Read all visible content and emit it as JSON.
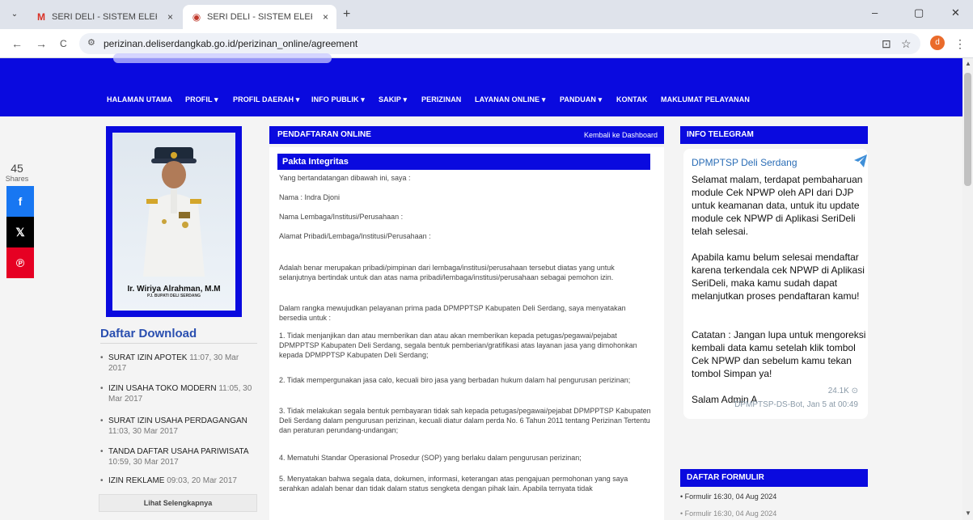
{
  "browser": {
    "tab_menu_icon": "chevron-down-icon",
    "tabs": [
      {
        "title": "SERI DELI - SISTEM ELEKTRONI",
        "icon": "gmail-icon",
        "close": "×"
      },
      {
        "title": "SERI DELI - SISTEM ELEKTRONI",
        "icon": "site-favicon",
        "close": "×"
      }
    ],
    "new_tab": "+",
    "url": "perizinan.deliserdangkab.go.id/perizinan_online/agreement",
    "profile_initial": "d",
    "back": "←",
    "forward": "→",
    "reload": "C",
    "install": "⊡",
    "star": "☆",
    "menu": "⋮",
    "minimize": "–",
    "maximize": "▢",
    "close": "✕"
  },
  "nav": {
    "items": [
      "HALAMAN UTAMA",
      "PROFIL ▾",
      "PROFIL DAERAH ▾",
      "INFO PUBLIK ▾",
      "SAKIP ▾",
      "PERIZINAN",
      "LAYANAN ONLINE ▾",
      "PANDUAN ▾",
      "KONTAK",
      "MAKLUMAT PELAYANAN"
    ]
  },
  "share": {
    "count": "45",
    "label": "Shares",
    "buttons": [
      {
        "name": "facebook",
        "glyph": "f",
        "color": "#1877f2"
      },
      {
        "name": "x",
        "glyph": "𝕏",
        "color": "#000000"
      },
      {
        "name": "pinterest",
        "glyph": "℗",
        "color": "#e60023"
      }
    ]
  },
  "profile": {
    "name": "Ir. Wiriya Alrahman, M.M",
    "title": "PJ. BUPATI DELI SERDANG"
  },
  "downloads": {
    "title": "Daftar Download",
    "items": [
      {
        "name": "SURAT IZIN APOTEK",
        "date": "11:07, 30 Mar 2017"
      },
      {
        "name": "IZIN USAHA TOKO MODERN",
        "date": "11:05, 30 Mar 2017"
      },
      {
        "name": "SURAT IZIN USAHA PERDAGANGAN",
        "date": "11:03, 30 Mar 2017"
      },
      {
        "name": "TANDA DAFTAR USAHA PARIWISATA",
        "date": "10:59, 30 Mar 2017"
      },
      {
        "name": "IZIN REKLAME",
        "date": "09:03, 20 Mar 2017"
      }
    ],
    "more": "Lihat Selengkapnya"
  },
  "main": {
    "title": "PENDAFTARAN ONLINE",
    "back_link": "Kembali ke Dashboard",
    "section": "Pakta Integritas",
    "paragraphs": [
      "Yang bertandatangan dibawah ini, saya :",
      "Nama : Indra Djoni",
      "Nama Lembaga/Institusi/Perusahaan :",
      "Alamat Pribadi/Lembaga/Institusi/Perusahaan :",
      "Adalah benar merupakan pribadi/pimpinan dari lembaga/institusi/perusahaan tersebut diatas yang untuk selanjutnya bertindak untuk dan atas nama pribadi/lembaga/institusi/perusahaan sebagai pemohon izin.",
      "Dalam rangka mewujudkan pelayanan prima pada DPMPPTSP Kabupaten Deli Serdang, saya menyatakan bersedia untuk :",
      "1. Tidak menjanjikan dan atau memberikan dan atau akan memberikan kepada petugas/pegawai/pejabat DPMPPTSP Kabupaten Deli Serdang, segala bentuk pemberian/gratifikasi atas layanan jasa yang dimohonkan kepada DPMPPTSP Kabupaten Deli Serdang;",
      "2. Tidak mempergunakan jasa calo, kecuali biro jasa yang berbadan hukum dalam hal pengurusan perizinan;",
      "3. Tidak melakukan segala bentuk pembayaran tidak sah kepada petugas/pegawai/pejabat DPMPPTSP Kabupaten Deli Serdang dalam pengurusan perizinan, kecuali diatur dalam perda No. 6 Tahun 2011 tentang Perizinan Tertentu dan peraturan perundang-undangan;",
      "4. Mematuhi Standar Operasional Prosedur (SOP) yang berlaku dalam pengurusan perizinan;",
      "5. Menyatakan bahwa segala data, dokumen, informasi, keterangan atas pengajuan permohonan yang saya serahkan adalah benar dan tidak dalam status sengketa dengan pihak lain. Apabila ternyata tidak"
    ]
  },
  "telegram": {
    "title": "INFO TELEGRAM",
    "channel": "DPMPTSP Deli Serdang",
    "message": [
      "Selamat malam, terdapat pembaharuan module Cek NPWP oleh API dari DJP untuk keamanan data, untuk itu update module cek NPWP di Aplikasi SeriDeli telah selesai.",
      "Apabila kamu belum selesai mendaftar karena terkendala cek NPWP di Aplikasi SeriDeli, maka kamu sudah dapat melanjutkan proses pendaftaran kamu!",
      "Catatan : Jangan lupa untuk mengoreksi kembali data kamu setelah klik tombol Cek NPWP dan sebelum kamu tekan tombol Simpan ya!",
      "Salam Admin A"
    ],
    "views": "24.1K ⊙",
    "meta": "DPMPTSP-DS-Bot, Jan 5 at 00:49"
  },
  "formulir": {
    "title": "DAFTAR FORMULIR",
    "items": [
      "Formulir 16:30, 04 Aug 2024",
      "Formulir 16:30, 04 Aug 2024"
    ]
  }
}
